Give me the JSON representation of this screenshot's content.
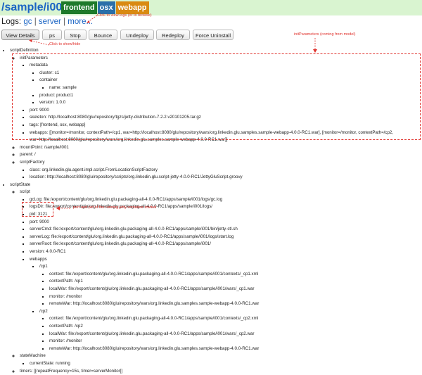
{
  "page": {
    "title": "/sample/i001",
    "tags": [
      {
        "label": "frontend",
        "color": "#1e7a2a"
      },
      {
        "label": "osx",
        "color": "#2a6fa8"
      },
      {
        "label": "webapp",
        "color": "#d98a12"
      }
    ],
    "annotation_color": "#e0332e"
  },
  "notes": {
    "view_logs": "Click to view logs (or to browse)",
    "show_hide": "Click to show/hide",
    "init_params": "initParameters (coming from model)",
    "port_pid": "port and pid of the running jetty container started"
  },
  "logs": {
    "label": "Logs:",
    "links": [
      "gc",
      "server",
      "more..."
    ],
    "separator": "|"
  },
  "toolbar": {
    "buttons": [
      "View Details",
      "ps",
      "Stop",
      "Bounce",
      "Undeploy",
      "Redeploy",
      "Force Uninstall"
    ]
  },
  "tree": [
    {
      "t": "scriptDefinition",
      "c": [
        {
          "t": "initParameters",
          "c": [
            {
              "t": "metadata",
              "c": [
                {
                  "t": "cluster: c1"
                },
                {
                  "t": "container",
                  "c": [
                    {
                      "t": "name: sample"
                    }
                  ]
                },
                {
                  "t": "product: product1"
                },
                {
                  "t": "version: 1.0.0"
                }
              ]
            },
            {
              "t": "port: 9000"
            },
            {
              "t": "skeleton: http://localhost:8080/glu/repository/tgzs/jetty-distribution-7.2.2.v20101205.tar.gz"
            },
            {
              "t": "tags: [frontend, osx, webapp]"
            },
            {
              "t": "webapps: [[monitor=/monitor, contextPath=/cp1, war=http://localhost:8080/glu/repository/wars/org.linkedin.glu.samples.sample-webapp-4.0.0-RC1.war], [monitor=/monitor, contextPath=/cp2, war=http://localhost:8080/glu/repository/wars/org.linkedin.glu.samples.sample-webapp-4.0.0-RC1.war]]",
              "wrap": true
            }
          ]
        },
        {
          "t": "mountPoint: /sample/i001"
        },
        {
          "t": "parent: /"
        },
        {
          "t": "scriptFactory",
          "c": [
            {
              "t": "class: org.linkedin.glu.agent.impl.script.FromLocationScriptFactory"
            },
            {
              "t": "location: http://localhost:8080/glu/repository/scripts/org.linkedin.glu.script-jetty-4.0.0-RC1/JettyGluScript.groovy"
            }
          ]
        }
      ]
    },
    {
      "t": "scriptState",
      "c": [
        {
          "t": "script",
          "c": [
            {
              "t": "gcLog: file:/export/content/glu/org.linkedin.glu.packaging-all-4.0.0-RC1/apps/sample/i001/logs/gc.log"
            },
            {
              "t": "logsDir: file:/export/content/glu/org.linkedin.glu.packaging-all-4.0.0-RC1/apps/sample/i001/logs/"
            },
            {
              "t": "pid: 3121"
            },
            {
              "t": "port: 9000"
            },
            {
              "t": "serverCmd: file:/export/content/glu/org.linkedin.glu.packaging-all-4.0.0-RC1/apps/sample/i001/bin/jetty-ctl.sh"
            },
            {
              "t": "serverLog: file:/export/content/glu/org.linkedin.glu.packaging-all-4.0.0-RC1/apps/sample/i001/logs/start.log"
            },
            {
              "t": "serverRoot: file:/export/content/glu/org.linkedin.glu.packaging-all-4.0.0-RC1/apps/sample/i001/"
            },
            {
              "t": "version: 4.0.0-RC1"
            },
            {
              "t": "webapps",
              "c": [
                {
                  "t": "/cp1",
                  "c": [
                    {
                      "t": "context: file:/export/content/glu/org.linkedin.glu.packaging-all-4.0.0-RC1/apps/sample/i001/contexts/_cp1.xml"
                    },
                    {
                      "t": "contextPath: /cp1"
                    },
                    {
                      "t": "localWar: file:/export/content/glu/org.linkedin.glu.packaging-all-4.0.0-RC1/apps/sample/i001/wars/_cp1.war"
                    },
                    {
                      "t": "monitor: /monitor"
                    },
                    {
                      "t": "remoteWar: http://localhost:8080/glu/repository/wars/org.linkedin.glu.samples.sample-webapp-4.0.0-RC1.war"
                    }
                  ]
                },
                {
                  "t": "/cp2",
                  "c": [
                    {
                      "t": "context: file:/export/content/glu/org.linkedin.glu.packaging-all-4.0.0-RC1/apps/sample/i001/contexts/_cp2.xml"
                    },
                    {
                      "t": "contextPath: /cp2"
                    },
                    {
                      "t": "localWar: file:/export/content/glu/org.linkedin.glu.packaging-all-4.0.0-RC1/apps/sample/i001/wars/_cp2.war"
                    },
                    {
                      "t": "monitor: /monitor"
                    },
                    {
                      "t": "remoteWar: http://localhost:8080/glu/repository/wars/org.linkedin.glu.samples.sample-webapp-4.0.0-RC1.war"
                    }
                  ]
                }
              ]
            }
          ]
        },
        {
          "t": "stateMachine",
          "c": [
            {
              "t": "currentState: running"
            }
          ]
        },
        {
          "t": "timers: [[repeatFrequency=15s, timer=serverMonitor]]"
        }
      ]
    }
  ]
}
